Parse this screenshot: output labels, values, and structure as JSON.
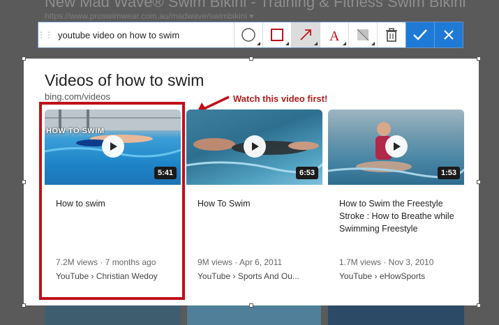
{
  "background_page": {
    "title": "New Mad Wave® Swim Bikini - Training & Fitness Swim Bikini",
    "url": "https://www.proswimwear.com.au/madwave/swimbikini ▾"
  },
  "toolbar": {
    "text_value": "youtube video on how to swim",
    "tools": [
      "ellipse-tool",
      "rectangle-tool",
      "arrow-tool",
      "text-tool",
      "blur-tool",
      "delete-tool"
    ],
    "ok_icon": "checkmark-icon",
    "cancel_icon": "close-icon",
    "accent": "#1f7ad6"
  },
  "capture": {
    "heading": "Videos of how to swim",
    "source": "bing.com/videos",
    "annotation": "Watch this video first!",
    "annotation_color": "#b01c1c",
    "videos": [
      {
        "title": "How to swim",
        "duration": "5:41",
        "meta": "7.2M views · 7 months ago",
        "source": "YouTube › Christian Wedoy",
        "thumb_caption": "HOW TO SWIM"
      },
      {
        "title": "How To Swim",
        "duration": "6:53",
        "meta": "9M views · Apr 6, 2011",
        "source": "YouTube › Sports And Ou..."
      },
      {
        "title": "How to Swim the Freestyle Stroke : How to Breathe while Swimming Freestyle",
        "duration": "1:53",
        "meta": "1.7M views · Nov 3, 2010",
        "source": "YouTube › eHowSports"
      }
    ]
  }
}
